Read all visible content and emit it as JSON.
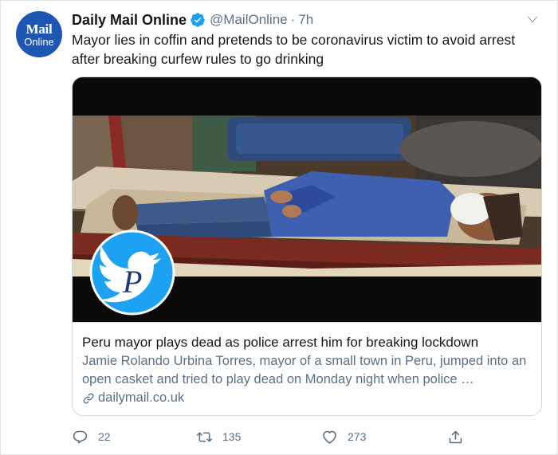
{
  "account": {
    "avatar_line1": "Mail",
    "avatar_line2": "Online",
    "display_name": "Daily Mail Online",
    "handle": "@MailOnline",
    "separator": "·",
    "time": "7h",
    "verified_icon": "verified-badge-icon",
    "brand_color": "#1d56b3"
  },
  "tweet": {
    "text": "Mayor lies in coffin and pretends to be coronavirus victim to avoid arrest after breaking curfew rules to go drinking"
  },
  "card": {
    "title": "Peru mayor plays dead as police arrest him for breaking lockdown",
    "description": "Jamie Rolando Urbina Torres, mayor of a small town in Peru, jumped into an open casket and tried to play dead on Monday night when police …",
    "domain": "dailymail.co.uk",
    "watermark_letter": "P"
  },
  "actions": {
    "replies": "22",
    "retweets": "135",
    "likes": "273"
  },
  "colors": {
    "accent": "#1da1f2",
    "muted_text": "#5b7083",
    "border": "#cfd9de"
  }
}
